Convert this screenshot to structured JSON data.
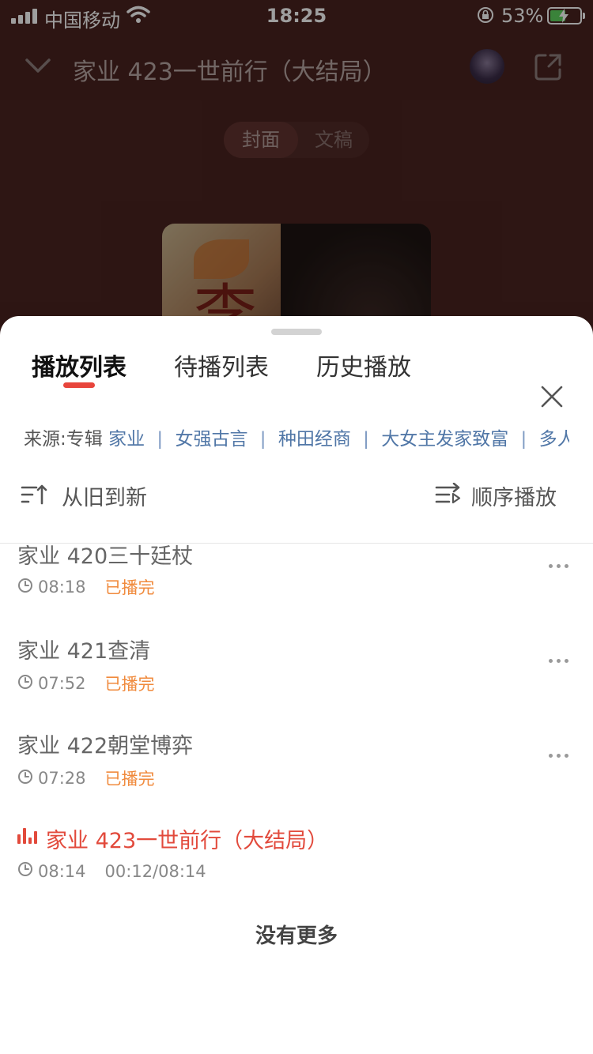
{
  "status_bar": {
    "carrier": "中国移动",
    "time": "18:25",
    "battery_percent": "53%",
    "battery_level": 0.53,
    "icons": [
      "signal-icon",
      "wifi-icon",
      "orientation-lock-icon",
      "battery-charging-icon"
    ]
  },
  "player": {
    "title": "家业 423一世前行（大结局）",
    "toggle": {
      "cover_label": "封面",
      "script_label": "文稿"
    },
    "cover_text": "李"
  },
  "sheet": {
    "tabs": [
      {
        "label": "播放列表",
        "active": true
      },
      {
        "label": "待播列表",
        "active": false
      },
      {
        "label": "历史播放",
        "active": false
      }
    ],
    "source": {
      "prefix": "来源:专辑",
      "tags": [
        "家业",
        "女强古言",
        "种田经商",
        "大女主发家致富",
        "多人..."
      ]
    },
    "sort_label": "从旧到新",
    "play_mode_label": "顺序播放",
    "tracks": [
      {
        "title": "家业 420三十廷杖",
        "duration": "08:18",
        "status": "已播完"
      },
      {
        "title": "家业 421查清",
        "duration": "07:52",
        "status": "已播完"
      },
      {
        "title": "家业 422朝堂博弈",
        "duration": "07:28",
        "status": "已播完"
      },
      {
        "title": "家业 423一世前行（大结局）",
        "duration": "08:14",
        "progress": "00:12/08:14",
        "current": true
      }
    ],
    "no_more": "没有更多"
  },
  "colors": {
    "accent": "#e24a3c",
    "played": "#f08a3c",
    "tag_blue": "#5177a7",
    "backdrop": "#4a2320"
  }
}
